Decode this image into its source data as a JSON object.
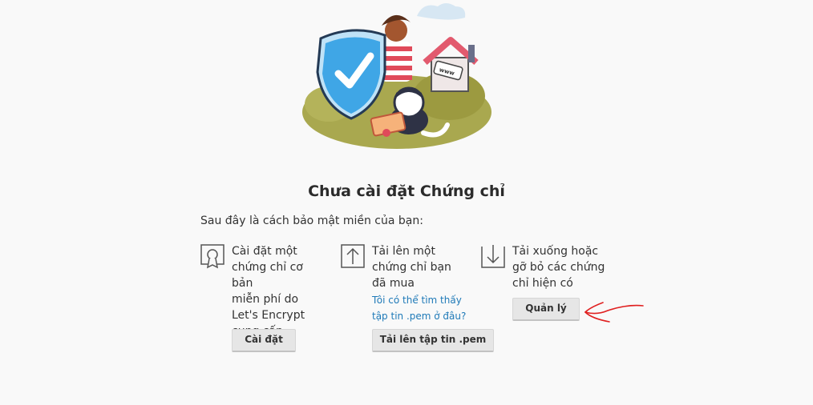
{
  "heading": "Chưa cài đặt Chứng chỉ",
  "intro": "Sau đây là cách bảo mật miền của bạn:",
  "options": [
    {
      "icon": "certificate-ribbon-icon",
      "text": "Cài đặt một\nchứng chỉ cơ bản\nmiễn phí do\nLet's Encrypt\ncung cấp",
      "button": "Cài đặt"
    },
    {
      "icon": "upload-arrow-icon",
      "text": "Tải lên một\nchứng chỉ bạn\nđã mua",
      "link": "Tôi có thể tìm thấy\ntập tin .pem ở đâu?",
      "button": "Tải lên tập tin .pem"
    },
    {
      "icon": "download-arrow-icon",
      "text": "Tải xuống hoặc\ngỡ bỏ các chứng\nchỉ hiện có",
      "button": "Quản lý"
    }
  ],
  "illustration": {
    "badge_text": "www"
  },
  "colors": {
    "link": "#1f7ab8",
    "annotation": "#e02020",
    "shield": "#3fa6e6"
  }
}
